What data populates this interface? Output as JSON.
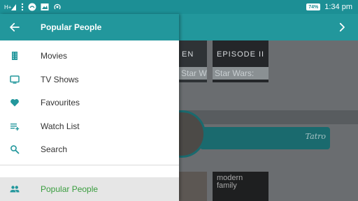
{
  "status_bar": {
    "time": "1:34",
    "time_suffix": "pm",
    "battery": "74%",
    "icons": [
      "signal-icon",
      "more-icon",
      "wifi-icon",
      "image-icon",
      "hotspot-icon"
    ]
  },
  "header": {
    "title": "Popular People",
    "back_icon": "arrow-left-icon",
    "forward_icon": "chevron-right-icon"
  },
  "drawer": {
    "items": [
      {
        "label": "Movies",
        "icon": "film-icon"
      },
      {
        "label": "TV Shows",
        "icon": "tv-icon"
      },
      {
        "label": "Favourites",
        "icon": "heart-icon"
      },
      {
        "label": "Watch List",
        "icon": "playlist-icon"
      },
      {
        "label": "Search",
        "icon": "search-icon"
      }
    ],
    "selected": {
      "label": "Popular People",
      "icon": "people-icon"
    }
  },
  "background": {
    "captions": [
      "Star Wars: Apo",
      "Star Wars:"
    ],
    "poster_text": [
      "EN",
      "EPISODE II"
    ],
    "poster_bottom": [
      "modern",
      "family"
    ],
    "card_signature": "Tatro"
  },
  "colors": {
    "primary": "#22979c",
    "status_bar": "#1c8f95",
    "selected_text": "#3a9d3f",
    "icon": "#22979c"
  }
}
